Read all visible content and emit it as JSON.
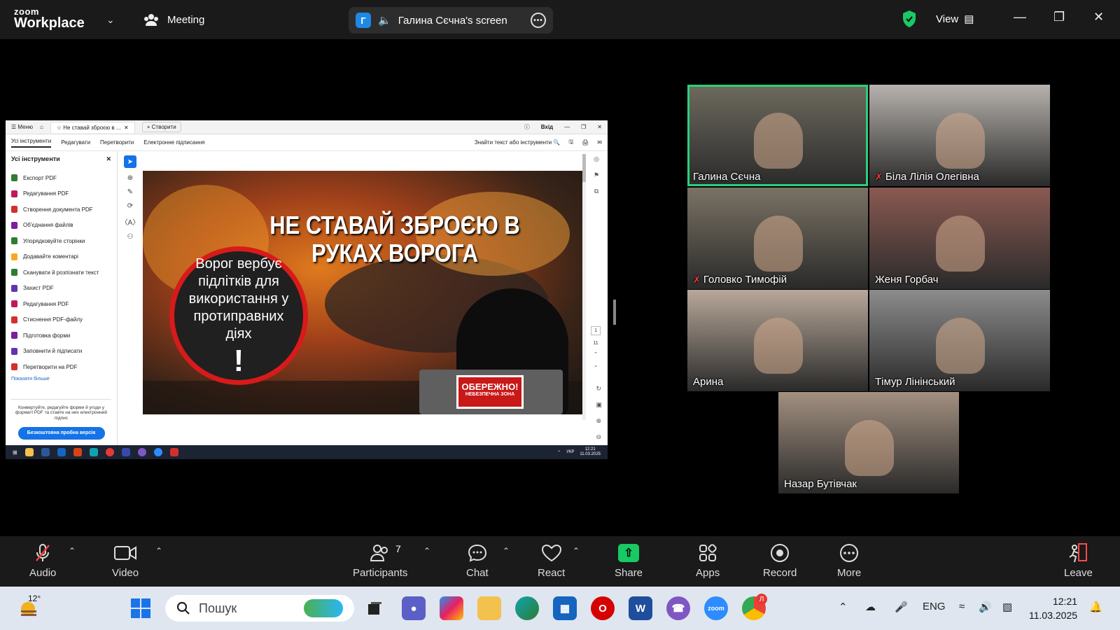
{
  "app": {
    "logo_top": "zoom",
    "logo_bottom": "Workplace",
    "meeting_label": "Meeting",
    "share_initial": "Г",
    "share_title": "Галина Сєчна's screen",
    "view_label": "View"
  },
  "shared_screen": {
    "title_bar": {
      "menu_label": "Меню",
      "tab_label": "Не ставай зброєю в ...",
      "new_tab_label": "Створити",
      "signin_label": "Вхід"
    },
    "menu_tabs": [
      "Усі інструменти",
      "Редагувати",
      "Перетворити",
      "Електронне підписання"
    ],
    "search_label": "Знайти текст або інструменти",
    "tools_panel": {
      "title": "Усі інструменти",
      "items": [
        {
          "label": "Експорт PDF",
          "color": "#2e7d32"
        },
        {
          "label": "Редагування PDF",
          "color": "#c2185b"
        },
        {
          "label": "Створення документа PDF",
          "color": "#d32f2f"
        },
        {
          "label": "Об'єднання файлів",
          "color": "#7b1fa2"
        },
        {
          "label": "Упорядковуйте сторінки",
          "color": "#2e7d32"
        },
        {
          "label": "Додавайте коментарі",
          "color": "#f9a825"
        },
        {
          "label": "Сканувати й розпізнати текст",
          "color": "#2e7d32"
        },
        {
          "label": "Захист PDF",
          "color": "#5e35b1"
        },
        {
          "label": "Редагування PDF",
          "color": "#c2185b"
        },
        {
          "label": "Стиснення PDF-файлу",
          "color": "#d32f2f"
        },
        {
          "label": "Підготовка форми",
          "color": "#7b1fa2"
        },
        {
          "label": "Заповнити й підписати",
          "color": "#5e35b1"
        },
        {
          "label": "Перетворити на PDF",
          "color": "#d32f2f"
        }
      ],
      "show_more": "Показати більше",
      "promo_text": "Конвертуйте, редагуйте форми й угоди у форматі PDF та ставте на них електронний підпис",
      "promo_button": "Безкоштовна пробна версія"
    },
    "document": {
      "title": "НЕ СТАВАЙ ЗБРОЄЮ В РУКАХ ВОРОГА",
      "circle_text": "Ворог вербує підлітків для використання у протиправних діях",
      "circle_exclaim": "!",
      "warning_main": "ОБЕРЕЖНО!",
      "warning_sub": "НЕБЕЗПЕЧНА ЗОНА"
    },
    "pager": {
      "current": "1",
      "total": "11"
    },
    "taskbar": {
      "lang": "УКР",
      "time": "12:21",
      "date": "11.03.2025"
    }
  },
  "participants": [
    {
      "name": "Галина Сєчна",
      "muted": false,
      "active": true,
      "bg": "#6e6a5e"
    },
    {
      "name": "Біла Лілія Олегівна",
      "muted": true,
      "active": false,
      "bg": "#b7b2ad"
    },
    {
      "name": "Головко Тимофій",
      "muted": true,
      "active": false,
      "bg": "#7a7264"
    },
    {
      "name": "Женя Горбач",
      "muted": false,
      "active": false,
      "bg": "#8a5a52"
    },
    {
      "name": "Арина",
      "muted": false,
      "active": false,
      "bg": "#b8a89a"
    },
    {
      "name": "Тімур Лінінський",
      "muted": false,
      "active": false,
      "bg": "#8c8c8c"
    },
    {
      "name": "Назар Бутівчак",
      "muted": false,
      "active": false,
      "bg": "#a39080"
    }
  ],
  "toolbar": {
    "audio": "Audio",
    "video": "Video",
    "participants": "Participants",
    "participants_count": "7",
    "chat": "Chat",
    "react": "React",
    "share": "Share",
    "apps": "Apps",
    "record": "Record",
    "more": "More",
    "leave": "Leave"
  },
  "windows_taskbar": {
    "temperature": "12°",
    "search_placeholder": "Пошук",
    "lang": "ENG",
    "time": "12:21",
    "date": "11.03.2025",
    "chrome_badge": "Л"
  },
  "colors": {
    "active_speaker": "#2ad07a",
    "share_green": "#18c964",
    "muted_red": "#ff3b3b",
    "acrobat_blue": "#1473e6"
  }
}
